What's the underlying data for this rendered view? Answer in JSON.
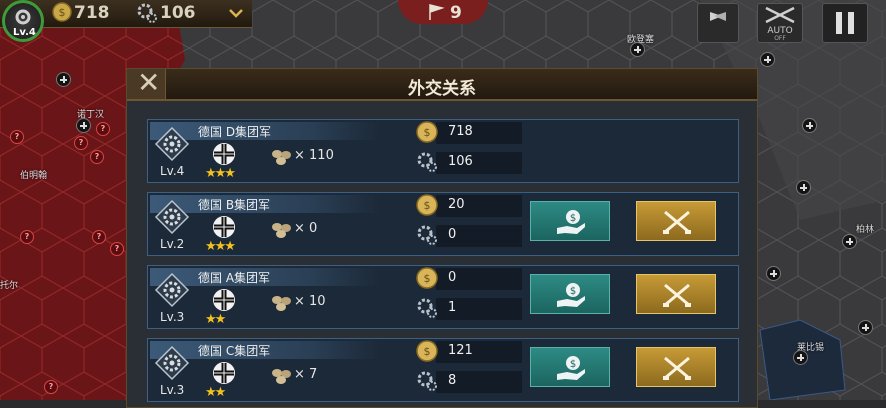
{
  "hud": {
    "level": "Lv.4",
    "gold": "718",
    "industry": "106",
    "turn": "9",
    "auto_label": "AUTO",
    "auto_sub": "OFF"
  },
  "map": {
    "labels": [
      "欧登塞",
      "诺丁汉",
      "伯明翰",
      "柏林",
      "莱比锡",
      "托尔"
    ]
  },
  "modal": {
    "title": "外交关系",
    "rows": [
      {
        "name": "德国 D集团军",
        "level": "Lv.4",
        "stars": 3,
        "resource": "× 110",
        "money": "718",
        "industry": "106",
        "show_actions": false
      },
      {
        "name": "德国 B集团军",
        "level": "Lv.2",
        "stars": 3,
        "resource": "× 0",
        "money": "20",
        "industry": "0",
        "show_actions": true
      },
      {
        "name": "德国 A集团军",
        "level": "Lv.3",
        "stars": 2,
        "resource": "× 10",
        "money": "0",
        "industry": "1",
        "show_actions": true
      },
      {
        "name": "德国 C集团军",
        "level": "Lv.3",
        "stars": 2,
        "resource": "× 7",
        "money": "121",
        "industry": "8",
        "show_actions": true
      }
    ]
  },
  "colors": {
    "aid_button": "#1f6f69",
    "war_button": "#b08a2d",
    "row_border": "#3c5f82",
    "star": "#f3c21e"
  },
  "icons": [
    "gold-coin-icon",
    "gear-icon",
    "chevron-down-icon",
    "flag-icon",
    "retreat-icon",
    "rifles-icon",
    "pause-icon",
    "close-icon",
    "iron-cross-icon",
    "money-hand-icon",
    "crossed-rifles-icon"
  ]
}
